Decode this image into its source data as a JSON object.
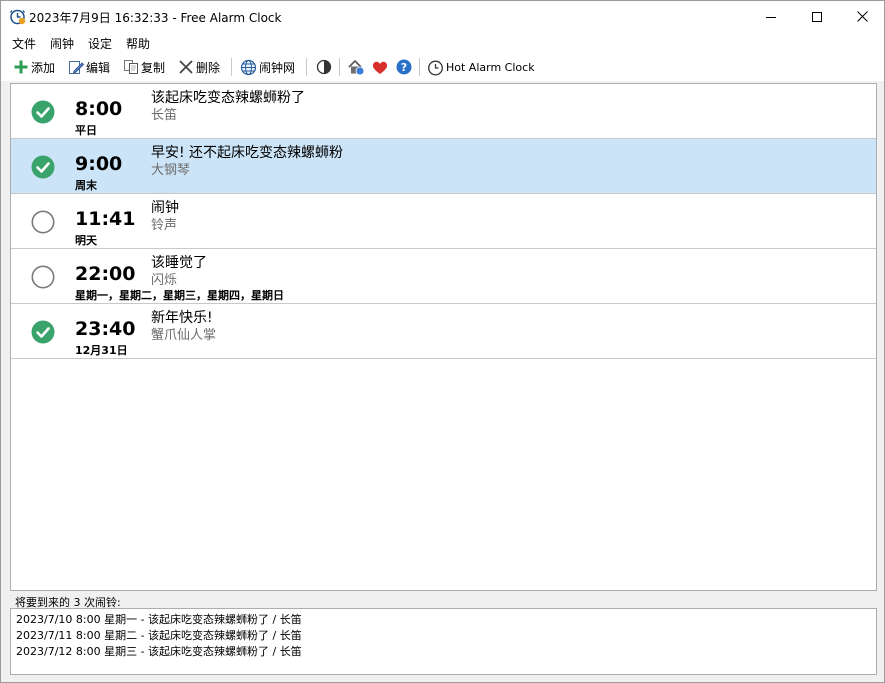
{
  "window": {
    "title": "2023年7月9日 16:32:33 - Free Alarm Clock"
  },
  "menu": {
    "items": [
      "文件",
      "闹钟",
      "设定",
      "帮助"
    ]
  },
  "toolbar": {
    "add_label": "添加",
    "edit_label": "编辑",
    "copy_label": "复制",
    "delete_label": "删除",
    "web_label": "闹钟网",
    "hot_label": "Hot Alarm Clock"
  },
  "alarms": [
    {
      "time": "8:00",
      "days": "平日",
      "message": "该起床吃变态辣螺蛳粉了",
      "sound": "长笛",
      "enabled": true,
      "selected": false
    },
    {
      "time": "9:00",
      "days": "周末",
      "message": "早安! 还不起床吃变态辣螺蛳粉",
      "sound": "大钢琴",
      "enabled": true,
      "selected": true
    },
    {
      "time": "11:41",
      "days": "明天",
      "message": "闹钟",
      "sound": "铃声",
      "enabled": false,
      "selected": false
    },
    {
      "time": "22:00",
      "days": "星期一，星期二，星期三，星期四，星期日",
      "message": "该睡觉了",
      "sound": "闪烁",
      "enabled": false,
      "selected": false
    },
    {
      "time": "23:40",
      "days": "12月31日",
      "message": "新年快乐!",
      "sound": "蟹爪仙人掌",
      "enabled": true,
      "selected": false
    }
  ],
  "upcoming": {
    "label": "将要到来的 3 次闹铃:",
    "lines": [
      "2023/7/10 8:00 星期一 - 该起床吃变态辣螺蛳粉了 / 长笛",
      "2023/7/11 8:00 星期二 - 该起床吃变态辣螺蛳粉了 / 长笛",
      "2023/7/12 8:00 星期三 - 该起床吃变态辣螺蛳粉了 / 长笛"
    ]
  },
  "colors": {
    "check_green": "#3aa36b",
    "selected_row": "#cce4f7",
    "sound_gray": "#6d6d6d",
    "heart_red": "#d9302c",
    "help_blue": "#2a6fc9"
  }
}
